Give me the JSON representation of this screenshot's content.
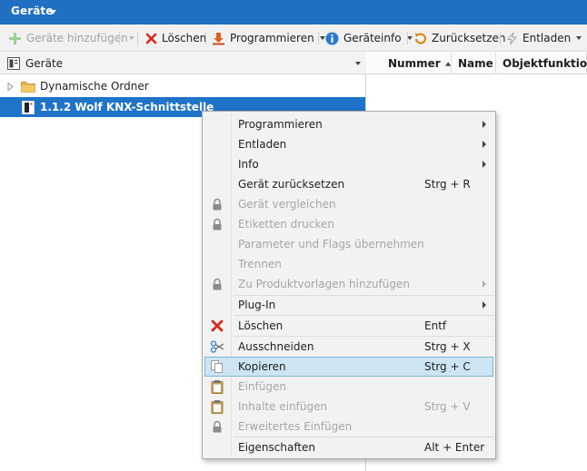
{
  "window": {
    "title": "Geräte"
  },
  "toolbar": {
    "add_label": "Geräte hinzufügen",
    "delete_label": "Löschen",
    "program_label": "Programmieren",
    "deviceinfo_label": "Geräteinfo",
    "reset_label": "Zurücksetzen",
    "unload_label": "Entladen"
  },
  "tree": {
    "header": "Geräte",
    "items": [
      {
        "label": "Dynamische Ordner"
      },
      {
        "label": "1.1.2 Wolf KNX-Schnittstelle"
      }
    ]
  },
  "columns": [
    "Nummer",
    "Name",
    "Objektfunktion"
  ],
  "menu": {
    "items": [
      {
        "label": "Programmieren",
        "shortcut": "",
        "icon": "",
        "enabled": true,
        "submenu": true
      },
      {
        "label": "Entladen",
        "shortcut": "",
        "icon": "",
        "enabled": true,
        "submenu": true
      },
      {
        "label": "Info",
        "shortcut": "",
        "icon": "",
        "enabled": true,
        "submenu": true
      },
      {
        "label": "Gerät zurücksetzen",
        "shortcut": "Strg + R",
        "icon": "",
        "enabled": true,
        "submenu": false
      },
      {
        "label": "Gerät vergleichen",
        "shortcut": "",
        "icon": "lock-icon",
        "enabled": false,
        "submenu": false
      },
      {
        "label": "Etiketten drucken",
        "shortcut": "",
        "icon": "lock-icon",
        "enabled": false,
        "submenu": false
      },
      {
        "label": "Parameter und Flags übernehmen",
        "shortcut": "",
        "icon": "",
        "enabled": false,
        "submenu": false
      },
      {
        "label": "Trennen",
        "shortcut": "",
        "icon": "",
        "enabled": false,
        "submenu": false
      },
      {
        "label": "Zu Produktvorlagen hinzufügen",
        "shortcut": "",
        "icon": "lock-icon",
        "enabled": false,
        "submenu": true
      },
      {
        "label": "Plug-In",
        "shortcut": "",
        "icon": "",
        "enabled": true,
        "submenu": true
      },
      {
        "label": "Löschen",
        "shortcut": "Entf",
        "icon": "delete-x-icon",
        "enabled": true,
        "submenu": false
      },
      {
        "label": "Ausschneiden",
        "shortcut": "Strg + X",
        "icon": "scissors-icon",
        "enabled": true,
        "submenu": false
      },
      {
        "label": "Kopieren",
        "shortcut": "Strg + C",
        "icon": "copy-icon",
        "enabled": true,
        "submenu": false,
        "highlighted": true
      },
      {
        "label": "Einfügen",
        "shortcut": "",
        "icon": "clipboard-icon",
        "enabled": false,
        "submenu": false
      },
      {
        "label": "Inhalte einfügen",
        "shortcut": "Strg + V",
        "icon": "clipboard-icon",
        "enabled": false,
        "submenu": false
      },
      {
        "label": "Erweitertes Einfügen",
        "shortcut": "",
        "icon": "lock-icon",
        "enabled": false,
        "submenu": false
      },
      {
        "label": "Eigenschaften",
        "shortcut": "Alt + Enter",
        "icon": "",
        "enabled": true,
        "submenu": false
      }
    ]
  },
  "colors": {
    "title_bar": "#1f6fc2",
    "selection": "#1f73c8",
    "menu_highlight": "#cde5f3",
    "delete_red": "#d9281c",
    "info_blue": "#2b78d0"
  }
}
